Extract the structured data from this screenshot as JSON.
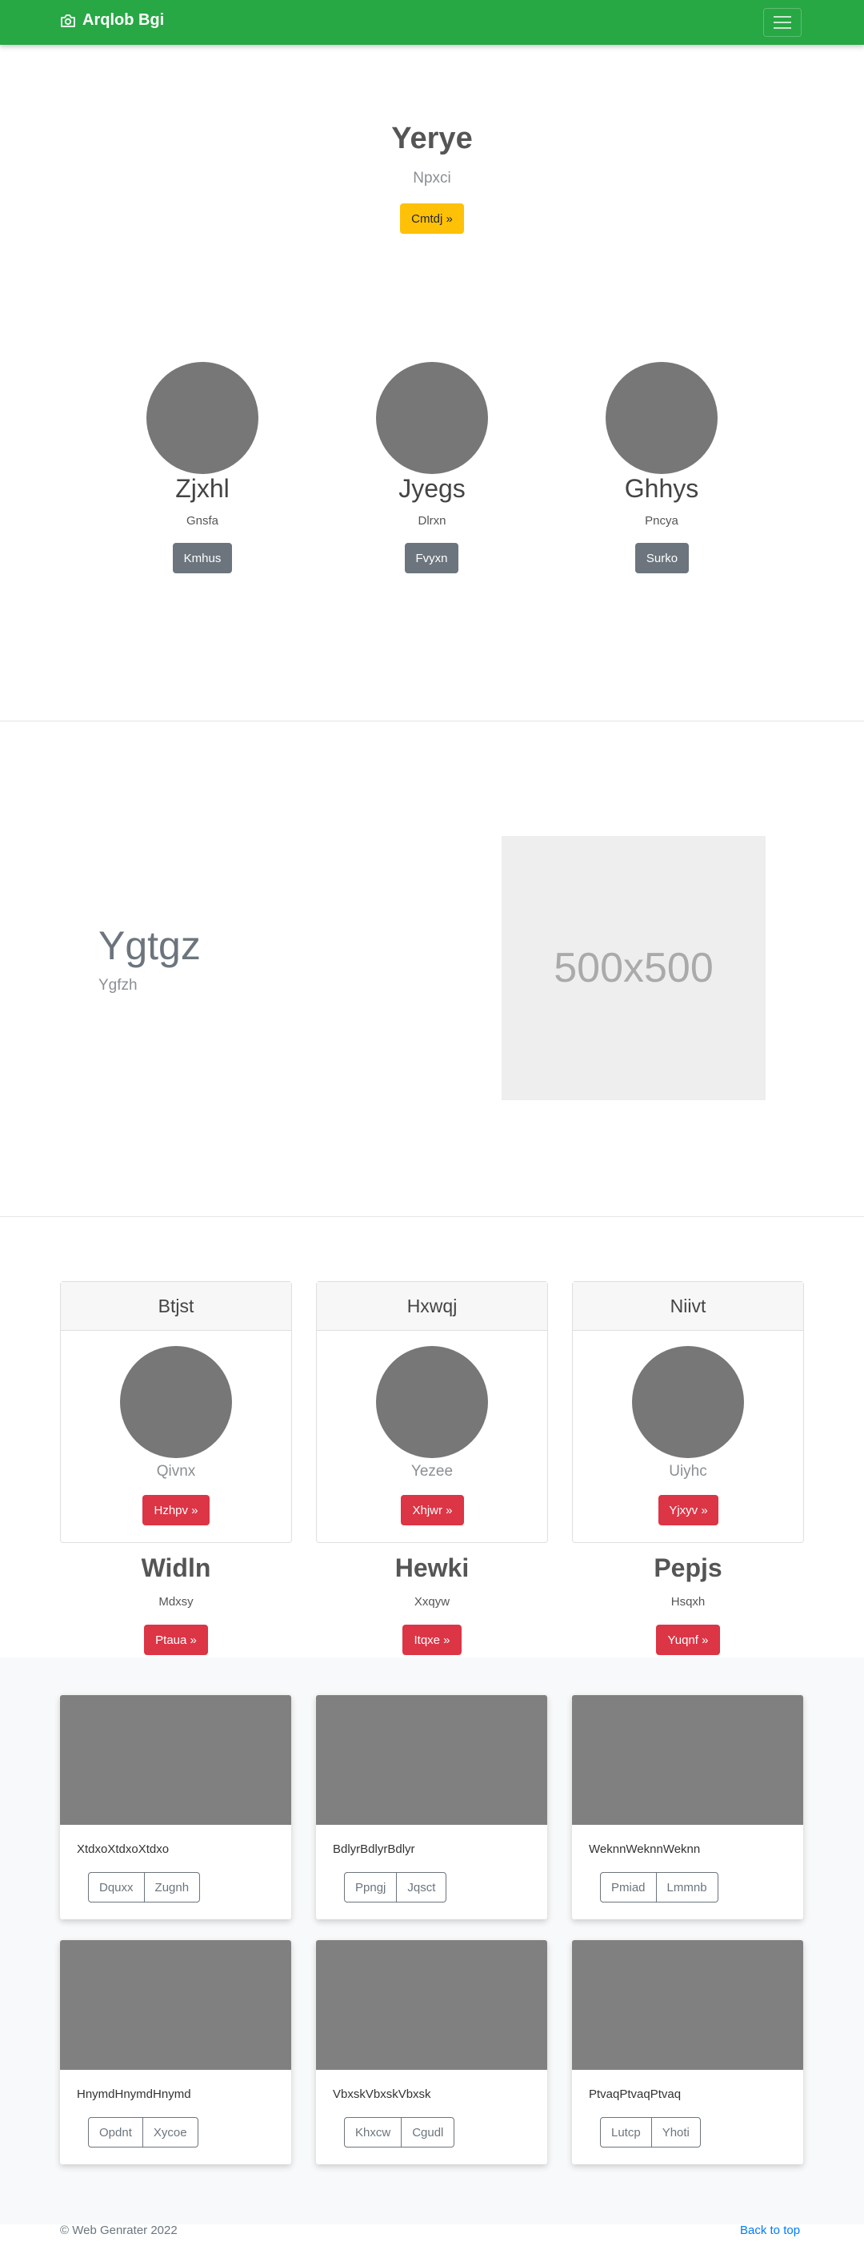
{
  "navbar": {
    "brand": "Arqlob Bgi",
    "brand_icon": "camera-icon",
    "toggler_icon": "hamburger-icon"
  },
  "hero": {
    "title": "Yerye",
    "subtitle": "Npxci",
    "button": "Cmtdj »"
  },
  "people": [
    {
      "name": "Zjxhl",
      "text": "Gnsfa",
      "button": "Kmhus"
    },
    {
      "name": "Jyegs",
      "text": "Dlrxn",
      "button": "Fvyxn"
    },
    {
      "name": "Ghhys",
      "text": "Pncya",
      "button": "Surko"
    }
  ],
  "feature": {
    "title": "Ygtgz",
    "subtitle": "Ygfzh",
    "image_label": "500x500"
  },
  "cards": [
    {
      "header": "Btjst",
      "text": "Qivnx",
      "button": "Hzhpv »"
    },
    {
      "header": "Hxwqj",
      "text": "Yezee",
      "button": "Xhjwr »"
    },
    {
      "header": "Niivt",
      "text": "Uiyhc",
      "button": "Yjxyv »"
    }
  ],
  "blurbs": [
    {
      "title": "Widln",
      "text": "Mdxsy",
      "button": "Ptaua »"
    },
    {
      "title": "Hewki",
      "text": "Xxqyw",
      "button": "Itqxe »"
    },
    {
      "title": "Pepjs",
      "text": "Hsqxh",
      "button": "Yuqnf »"
    }
  ],
  "album": [
    {
      "text": "XtdxoXtdxoXtdxo",
      "btn1": "Dquxx",
      "btn2": "Zugnh"
    },
    {
      "text": "BdlyrBdlyrBdlyr",
      "btn1": "Ppngj",
      "btn2": "Jqsct"
    },
    {
      "text": "WeknnWeknnWeknn",
      "btn1": "Pmiad",
      "btn2": "Lmmnb"
    },
    {
      "text": "HnymdHnymdHnymd",
      "btn1": "Opdnt",
      "btn2": "Xycoe"
    },
    {
      "text": "VbxskVbxskVbxsk",
      "btn1": "Khxcw",
      "btn2": "Cgudl"
    },
    {
      "text": "PtvaqPtvaqPtvaq",
      "btn1": "Lutcp",
      "btn2": "Yhoti"
    }
  ],
  "footer": {
    "copyright": "© Web Genrater 2022",
    "back_to_top": "Back to top"
  },
  "colors": {
    "navbar": "#28a745",
    "warning": "#ffc107",
    "secondary": "#6c757d",
    "danger": "#dc3545",
    "link": "#007bff"
  }
}
